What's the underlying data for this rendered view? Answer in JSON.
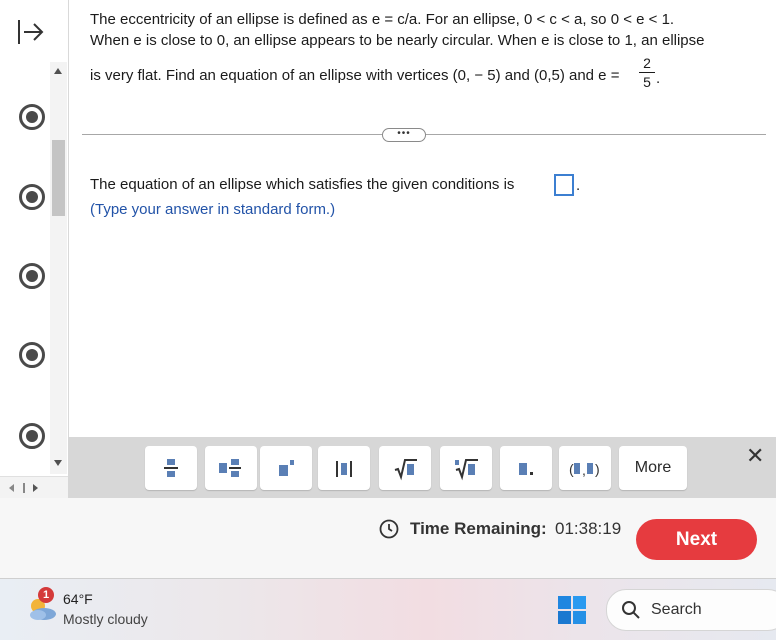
{
  "question": {
    "line1": "The eccentricity of an ellipse is defined as e = c/a. For an ellipse, 0 < c < a, so 0 < e < 1.",
    "line2": "When e is close to 0, an ellipse appears to be nearly circular. When e is close to 1, an ellipse",
    "line3": "is very flat. Find an equation of an ellipse with vertices (0, − 5) and (0,5) and e =",
    "frac_num": "2",
    "frac_den": "5",
    "frac_tail": ".",
    "more_dots": "•••"
  },
  "answer": {
    "prompt": "The equation of an ellipse which satisfies the given conditions is",
    "period": ".",
    "hint": "(Type your answer in standard form.)"
  },
  "toolbar": {
    "buttons": [
      {
        "name": "fraction-button",
        "glyph": "═"
      },
      {
        "name": "mixed-number-button",
        "glyph": "▪═"
      },
      {
        "name": "exponent-button",
        "glyph": "▪˙"
      },
      {
        "name": "absolute-value-button",
        "glyph": "|▪|"
      },
      {
        "name": "square-root-button",
        "glyph": "√▪"
      },
      {
        "name": "nth-root-button",
        "glyph": "∛▪"
      },
      {
        "name": "decimal-button",
        "glyph": "▪."
      },
      {
        "name": "ordered-pair-button",
        "glyph": "(▪,▪)"
      },
      {
        "name": "more-button",
        "glyph": "More"
      }
    ],
    "close": "✕"
  },
  "footer": {
    "time_label": "Time Remaining:",
    "time_value": "01:38:19",
    "next_label": "Next"
  },
  "taskbar": {
    "badge": "1",
    "temperature": "64°F",
    "condition": "Mostly cloudy",
    "search_label": "Search"
  },
  "colors": {
    "next_button": "#e63b3f",
    "answer_box_border": "#3c7fd1",
    "hint_text": "#2253a8"
  }
}
